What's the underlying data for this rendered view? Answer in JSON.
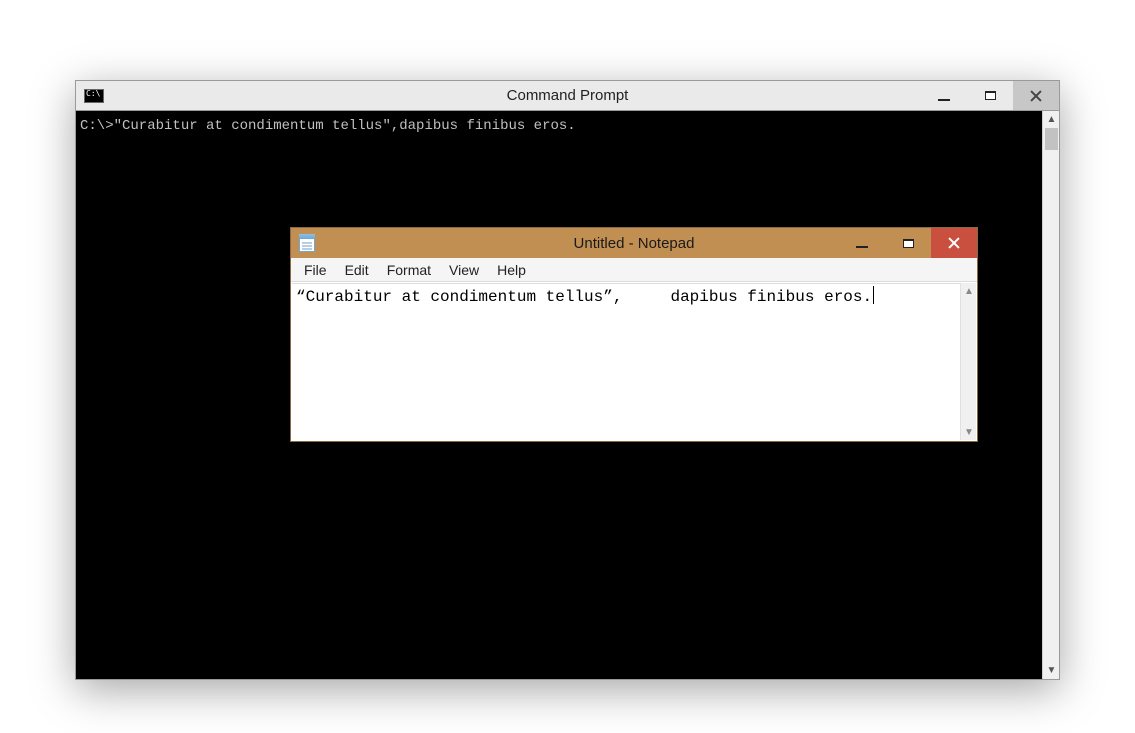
{
  "cmd": {
    "title": "Command Prompt",
    "prompt_line": "C:\\>\"Curabitur at condimentum tellus\",dapibus finibus eros."
  },
  "notepad": {
    "title": "Untitled - Notepad",
    "menu": {
      "file": "File",
      "edit": "Edit",
      "format": "Format",
      "view": "View",
      "help": "Help"
    },
    "body_text": "“Curabitur at condimentum tellus”,     dapibus finibus eros."
  }
}
